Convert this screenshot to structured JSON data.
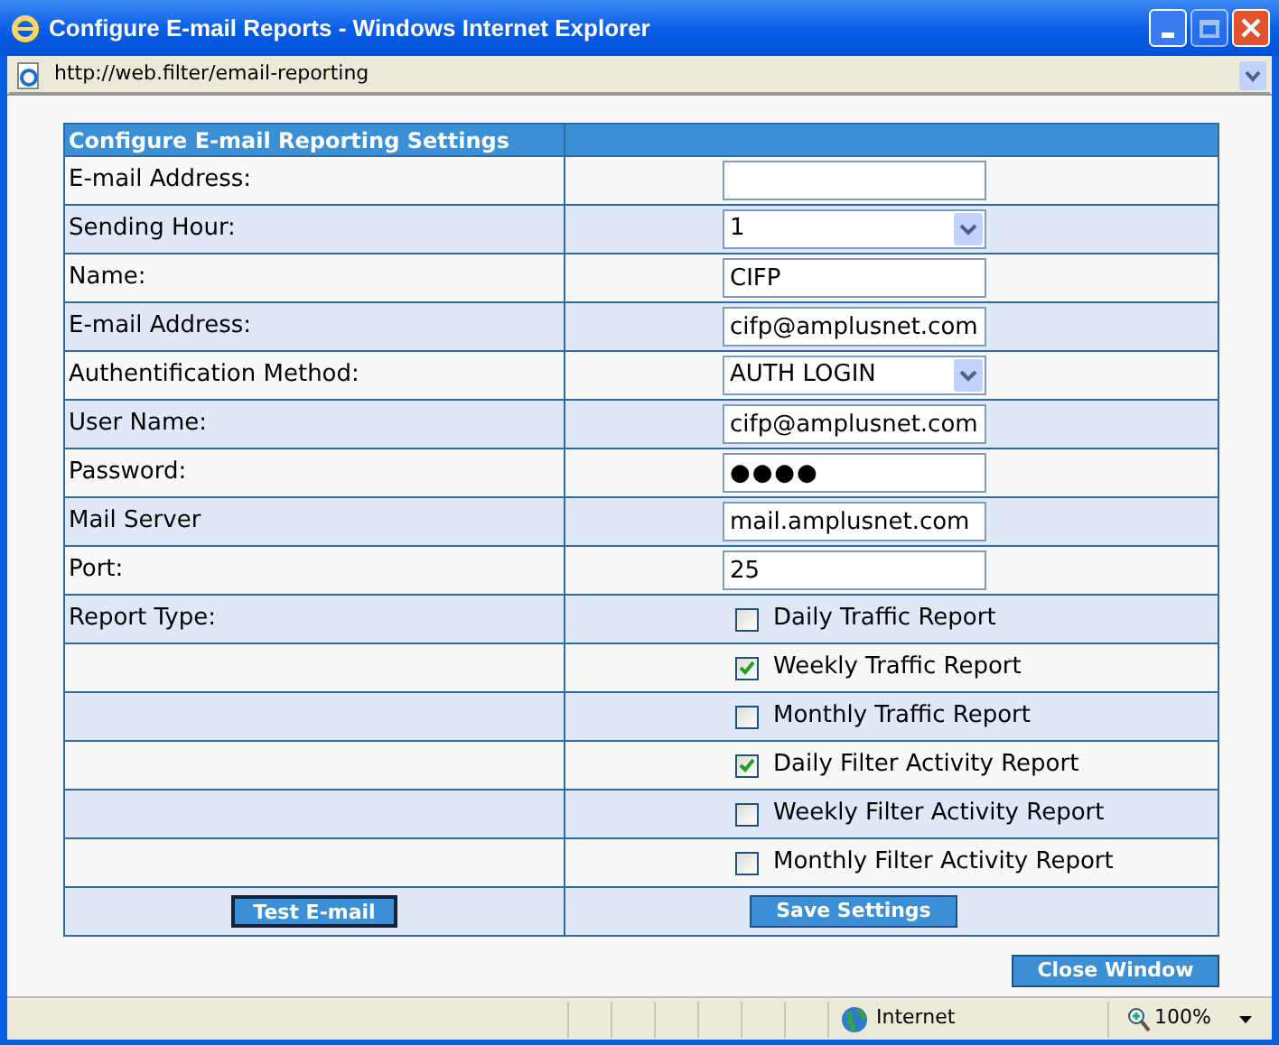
{
  "window": {
    "title": "Configure E-mail Reports - Windows Internet Explorer"
  },
  "address_bar": {
    "url": "http://web.filter/email-reporting"
  },
  "table": {
    "header": "Configure E-mail Reporting Settings",
    "fields": [
      {
        "label": "E-mail Address:",
        "kind": "text"
      },
      {
        "label": "Sending Hour:",
        "kind": "select",
        "value": "1"
      },
      {
        "label": "Name:",
        "kind": "text",
        "value": "CIFP"
      },
      {
        "label": "E-mail Address:",
        "kind": "text",
        "value": "cifp@amplusnet.com"
      },
      {
        "label": "Authentification Method:",
        "kind": "select",
        "value": "AUTH LOGIN"
      },
      {
        "label": "User Name:",
        "kind": "text",
        "value": "cifp@amplusnet.com"
      },
      {
        "label": "Password:",
        "kind": "password",
        "value": "●●●●"
      },
      {
        "label": "Mail Server",
        "kind": "text",
        "value": "mail.amplusnet.com"
      },
      {
        "label": "Port:",
        "kind": "text",
        "value": "25"
      }
    ],
    "report_type_label": "Report Type:",
    "reports": [
      {
        "label": "Daily Traffic Report",
        "checked": false
      },
      {
        "label": "Weekly Traffic Report",
        "checked": true
      },
      {
        "label": "Monthly Traffic Report",
        "checked": false
      },
      {
        "label": "Daily Filter Activity Report",
        "checked": true
      },
      {
        "label": "Weekly Filter Activity Report",
        "checked": false
      },
      {
        "label": "Monthly Filter Activity Report",
        "checked": false
      }
    ],
    "test_button": "Test E-mail",
    "save_button": "Save Settings"
  },
  "close_button": "Close Window",
  "status_bar": {
    "zone": "Internet",
    "zoom": "100%"
  }
}
